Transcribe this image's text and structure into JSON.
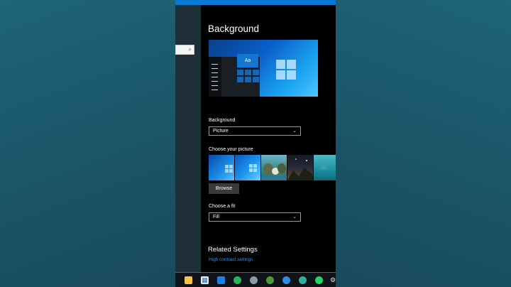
{
  "page": {
    "title": "Background"
  },
  "preview": {
    "tile_label": "Aa"
  },
  "background": {
    "label": "Background",
    "value": "Picture"
  },
  "choose_picture": {
    "label": "Choose your picture"
  },
  "browse_label": "Browse",
  "fit": {
    "label": "Choose a fit",
    "value": "Fill"
  },
  "related": {
    "heading": "Related Settings",
    "link": "High contrast settings"
  },
  "colors": {
    "accent": "#0a78d4",
    "panel": "#000000",
    "link": "#3f8dd8"
  },
  "thumbnails": [
    "windows-blue-1",
    "windows-blue-2",
    "beach-rocks",
    "night-sky",
    "underwater"
  ],
  "taskbar_icons": [
    "file-explorer-icon",
    "store-icon",
    "mail-icon",
    "spotify-icon",
    "app-icon",
    "xbox-icon",
    "edge-icon",
    "edge-dev-icon",
    "whatsapp-icon",
    "settings-icon"
  ]
}
